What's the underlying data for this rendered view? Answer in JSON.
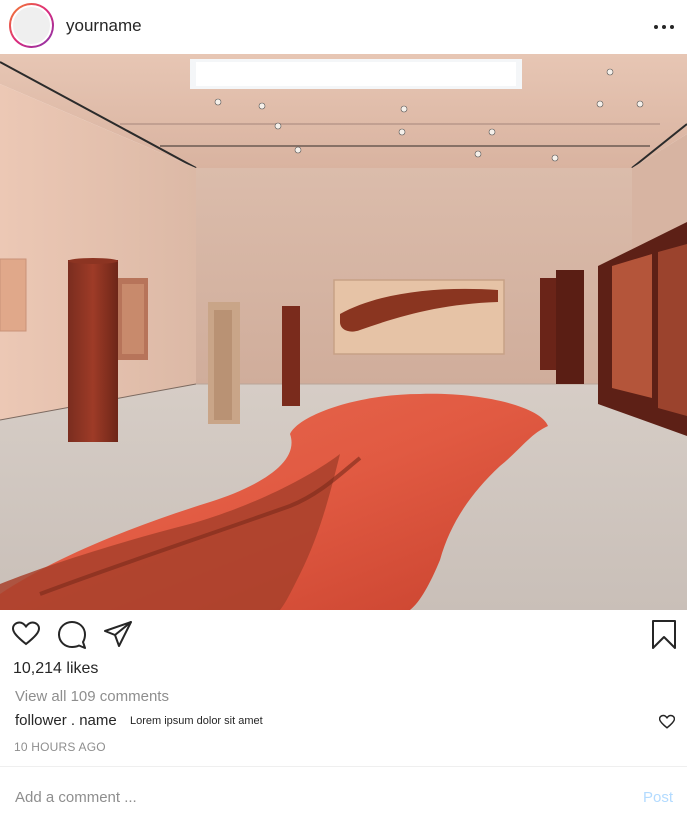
{
  "post": {
    "username": "yourname",
    "likes": "10,214 likes",
    "view_comments": "View all  109 comments",
    "comment": {
      "user": "follower . name",
      "text": "Lorem ipsum dolor sit amet"
    },
    "timestamp": "10 HOURS AGO",
    "add_comment_placeholder": "Add a comment ...",
    "post_label": "Post"
  },
  "icons": {
    "more": "more-options-icon",
    "like": "heart-icon",
    "comment": "speech-bubble-icon",
    "share": "paper-plane-icon",
    "save": "bookmark-icon",
    "comment_like": "small-heart-icon"
  },
  "colors": {
    "text": "#262626",
    "muted": "#8e8e8e",
    "post_button": "#b3dbff",
    "avatar_ring_start": "#f58529",
    "avatar_ring_end": "#8134af"
  }
}
